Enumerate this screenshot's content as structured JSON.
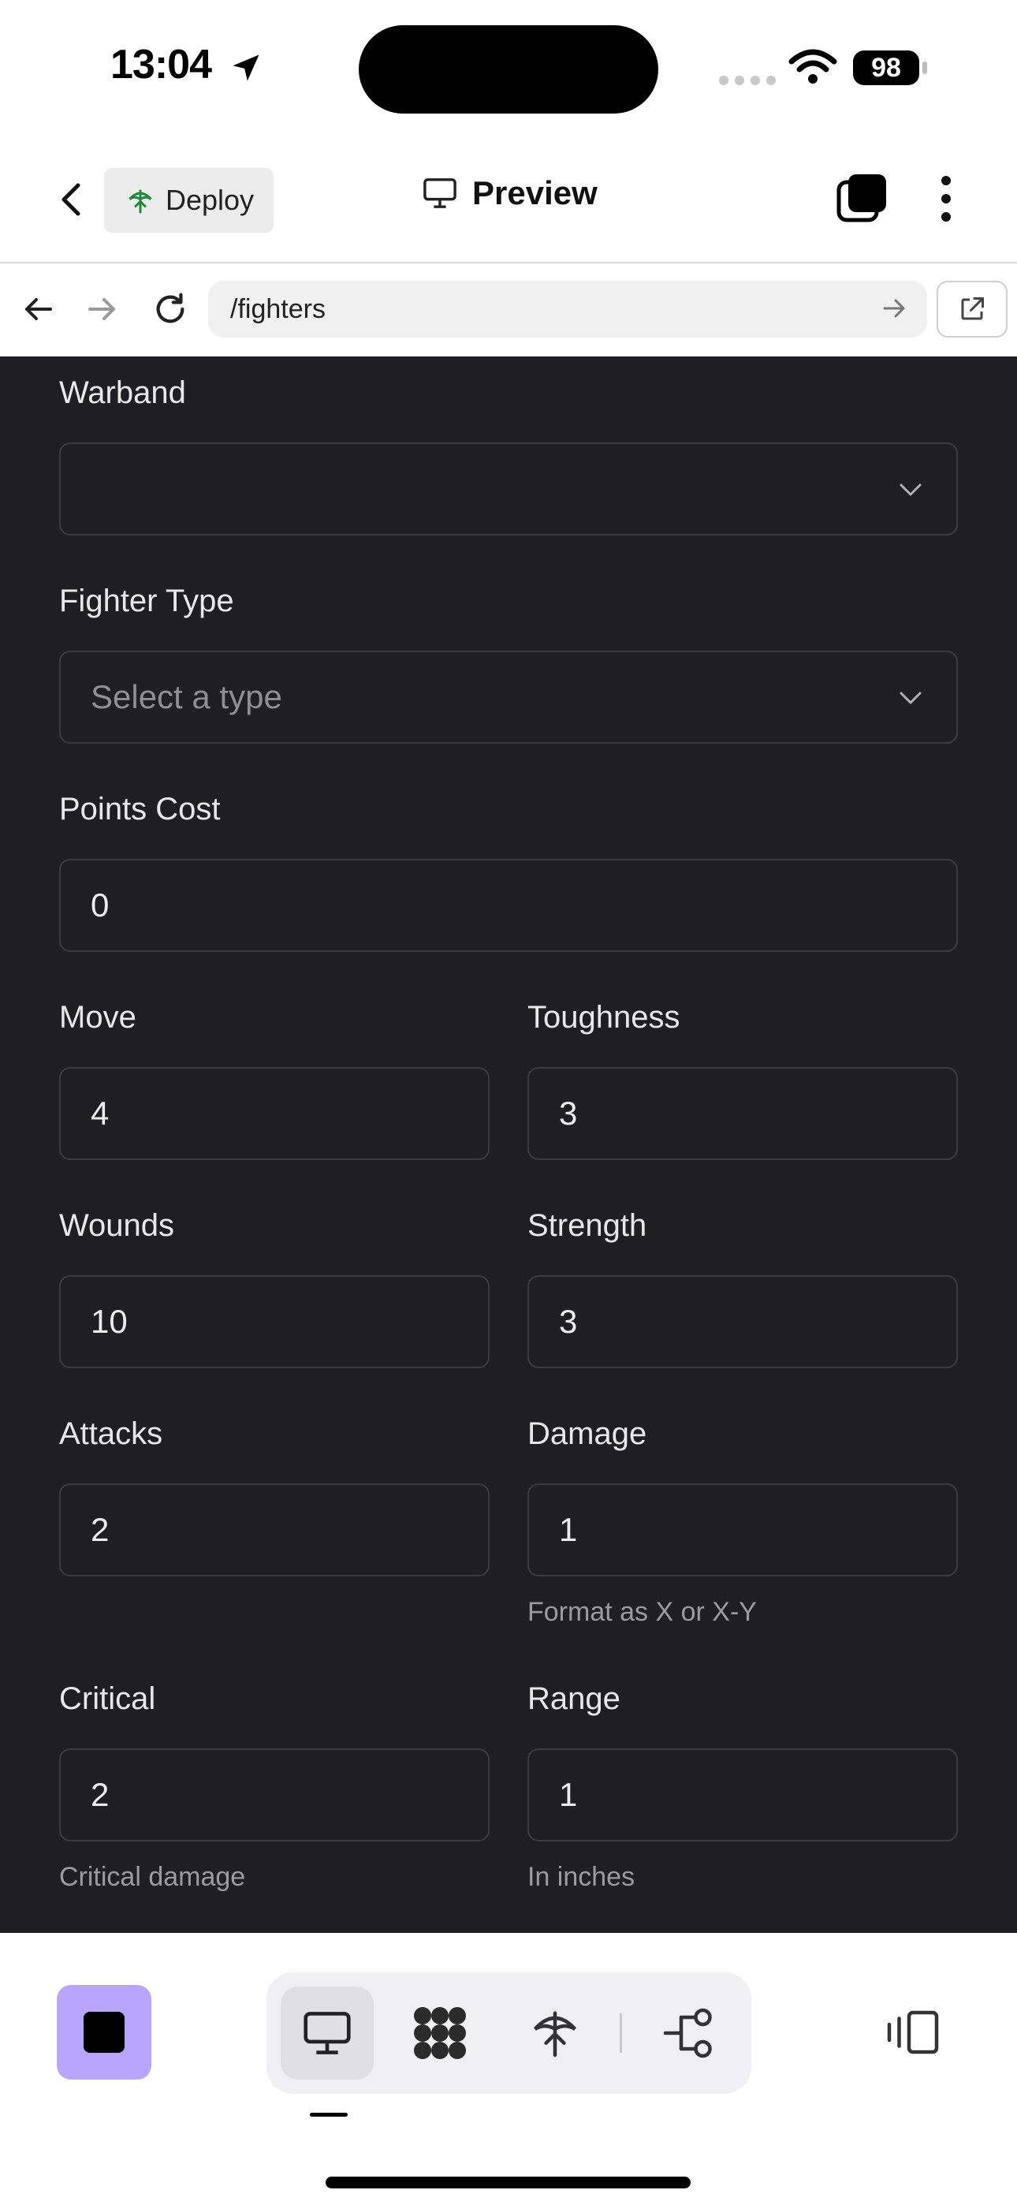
{
  "status_bar": {
    "time": "13:04",
    "battery": "98"
  },
  "header": {
    "deploy_label": "Deploy",
    "preview_label": "Preview"
  },
  "url_bar": {
    "path": "/fighters"
  },
  "form": {
    "warband": {
      "label": "Warband",
      "value": ""
    },
    "fighter_type": {
      "label": "Fighter Type",
      "placeholder": "Select a type"
    },
    "points_cost": {
      "label": "Points Cost",
      "value": "0"
    },
    "move": {
      "label": "Move",
      "value": "4"
    },
    "toughness": {
      "label": "Toughness",
      "value": "3"
    },
    "wounds": {
      "label": "Wounds",
      "value": "10"
    },
    "strength": {
      "label": "Strength",
      "value": "3"
    },
    "attacks": {
      "label": "Attacks",
      "value": "2"
    },
    "damage": {
      "label": "Damage",
      "value": "1",
      "hint": "Format as X or X-Y"
    },
    "critical": {
      "label": "Critical",
      "value": "2",
      "hint": "Critical damage"
    },
    "range": {
      "label": "Range",
      "value": "1",
      "hint": "In inches"
    }
  },
  "colors": {
    "form_background": "#1f1f23",
    "accent_stop": "#b7a6fb"
  },
  "toolbar": {
    "icons": [
      "stop-icon",
      "desktop-preview-icon",
      "grid-blocks-icon",
      "deploy-icon",
      "workflow-icon",
      "device-frame-icon"
    ]
  }
}
